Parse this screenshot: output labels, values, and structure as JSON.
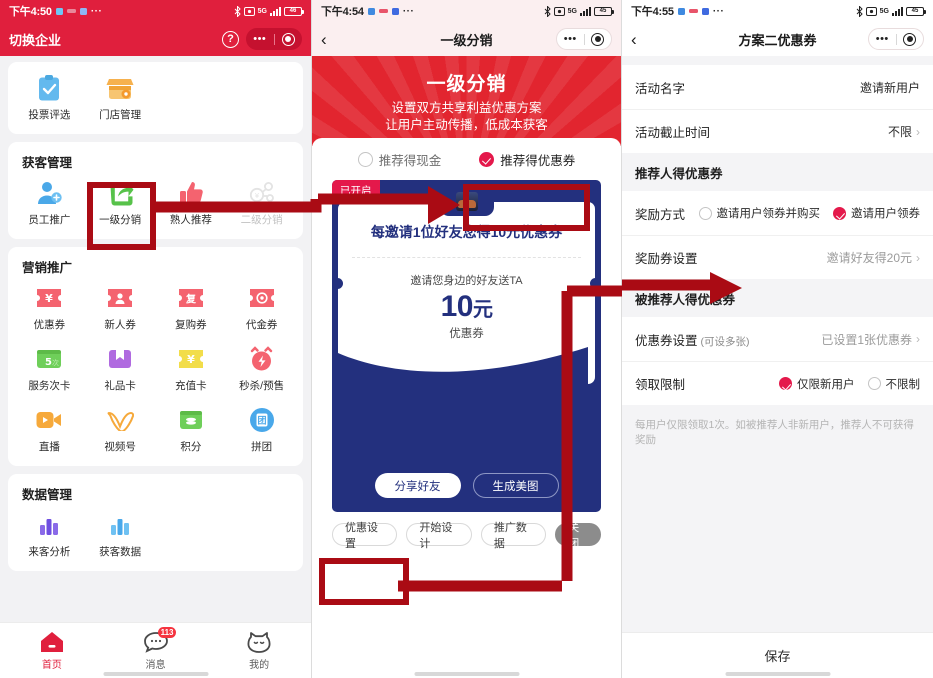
{
  "panels": {
    "left": {
      "status": {
        "time": "下午4:50",
        "battery": "46"
      },
      "nav": {
        "title": "切换企业",
        "help_icon": "help-icon",
        "more_icon": "more-icon",
        "target_icon": "target-icon"
      },
      "sections": [
        {
          "title": "",
          "items": [
            {
              "label": "投票评选",
              "icon": "clipboard-check-icon"
            },
            {
              "label": "门店管理",
              "icon": "storefront-icon"
            }
          ]
        },
        {
          "title": "获客管理",
          "items": [
            {
              "label": "员工推广",
              "icon": "user-plus-icon"
            },
            {
              "label": "一级分销",
              "icon": "share-arrow-icon"
            },
            {
              "label": "熟人推荐",
              "icon": "thumbs-up-icon"
            },
            {
              "label": "二级分销",
              "icon": "network-icon",
              "disabled": true
            }
          ]
        },
        {
          "title": "营销推广",
          "items": [
            {
              "label": "优惠券",
              "icon": "coupon-yen-icon"
            },
            {
              "label": "新人券",
              "icon": "coupon-person-icon"
            },
            {
              "label": "复购券",
              "icon": "coupon-repeat-icon"
            },
            {
              "label": "代金券",
              "icon": "coupon-voucher-icon"
            },
            {
              "label": "服务次卡",
              "icon": "times-card-icon"
            },
            {
              "label": "礼品卡",
              "icon": "gift-card-icon"
            },
            {
              "label": "充值卡",
              "icon": "recharge-card-icon"
            },
            {
              "label": "秒杀/预售",
              "icon": "alarm-flash-icon"
            },
            {
              "label": "直播",
              "icon": "video-camera-icon"
            },
            {
              "label": "视频号",
              "icon": "channels-icon"
            },
            {
              "label": "积分",
              "icon": "points-icon"
            },
            {
              "label": "拼团",
              "icon": "group-buy-icon"
            }
          ]
        },
        {
          "title": "数据管理",
          "items": [
            {
              "label": "来客分析",
              "icon": "bar-chart-purple-icon"
            },
            {
              "label": "获客数据",
              "icon": "bar-chart-blue-icon"
            }
          ]
        }
      ],
      "tabs": [
        {
          "label": "首页",
          "icon": "home-icon",
          "active": true,
          "badge": ""
        },
        {
          "label": "消息",
          "icon": "message-icon",
          "active": false,
          "badge": "113"
        },
        {
          "label": "我的",
          "icon": "profile-cat-icon",
          "active": false,
          "badge": ""
        }
      ]
    },
    "middle": {
      "status": {
        "time": "下午4:54",
        "battery": "45"
      },
      "nav": {
        "title": "一级分销",
        "back_icon": "back-chevron-icon",
        "more_icon": "more-icon",
        "target_icon": "target-icon"
      },
      "hero": {
        "title": "一级分销",
        "line1": "设置双方共享利益优惠方案",
        "line2": "让用户主动传播，低成本获客"
      },
      "options": [
        {
          "label": "推荐得现金",
          "selected": false
        },
        {
          "label": "推荐得优惠券",
          "selected": true
        }
      ],
      "poster": {
        "flag": "已开启",
        "headline": "每邀请1位好友您得10元优惠券",
        "sub": "邀请您身边的好友送TA",
        "amount": "10",
        "amount_unit": "元",
        "coupon_word": "优惠券",
        "buttons": [
          {
            "label": "分享好友",
            "style": "solid"
          },
          {
            "label": "生成美图",
            "style": "ghost"
          }
        ]
      },
      "bottom_actions": [
        {
          "label": "优惠设置",
          "style": "plain"
        },
        {
          "label": "开始设计",
          "style": "plain"
        },
        {
          "label": "推广数据",
          "style": "plain"
        },
        {
          "label": "关闭",
          "style": "close"
        }
      ]
    },
    "right": {
      "status": {
        "time": "下午4:55",
        "battery": "45"
      },
      "nav": {
        "title": "方案二优惠券",
        "back_icon": "back-chevron-icon",
        "more_icon": "more-icon",
        "target_icon": "target-icon"
      },
      "rows": [
        {
          "label": "活动名字",
          "value": "邀请新用户",
          "chevron": false,
          "gray": false
        },
        {
          "label": "活动截止时间",
          "value": "不限",
          "chevron": true,
          "gray": false
        }
      ],
      "section1": "推荐人得优惠券",
      "reward_row": {
        "label": "奖励方式",
        "options": [
          {
            "label": "邀请用户领券并购买",
            "selected": false
          },
          {
            "label": "邀请用户领券",
            "selected": true
          }
        ]
      },
      "reward_setting": {
        "label": "奖励券设置",
        "value": "邀请好友得20元",
        "chevron": true
      },
      "section2": "被推荐人得优惠券",
      "coupon_setting": {
        "label": "优惠券设置",
        "hint": "(可设多张)",
        "value": "已设置1张优惠券",
        "chevron": true
      },
      "limit_row": {
        "label": "领取限制",
        "options": [
          {
            "label": "仅限新用户",
            "selected": true
          },
          {
            "label": "不限制",
            "selected": false
          }
        ]
      },
      "note": "每用户仅限领取1次。如被推荐人非新用户，推荐人不可获得奖励",
      "save_label": "保存"
    }
  },
  "colors": {
    "brand_red": "#e01f3d",
    "hero_red": "#e2252f",
    "accent_pink": "#e4194b",
    "poster_blue": "#23307e",
    "annotation_red": "#aa0b14"
  }
}
